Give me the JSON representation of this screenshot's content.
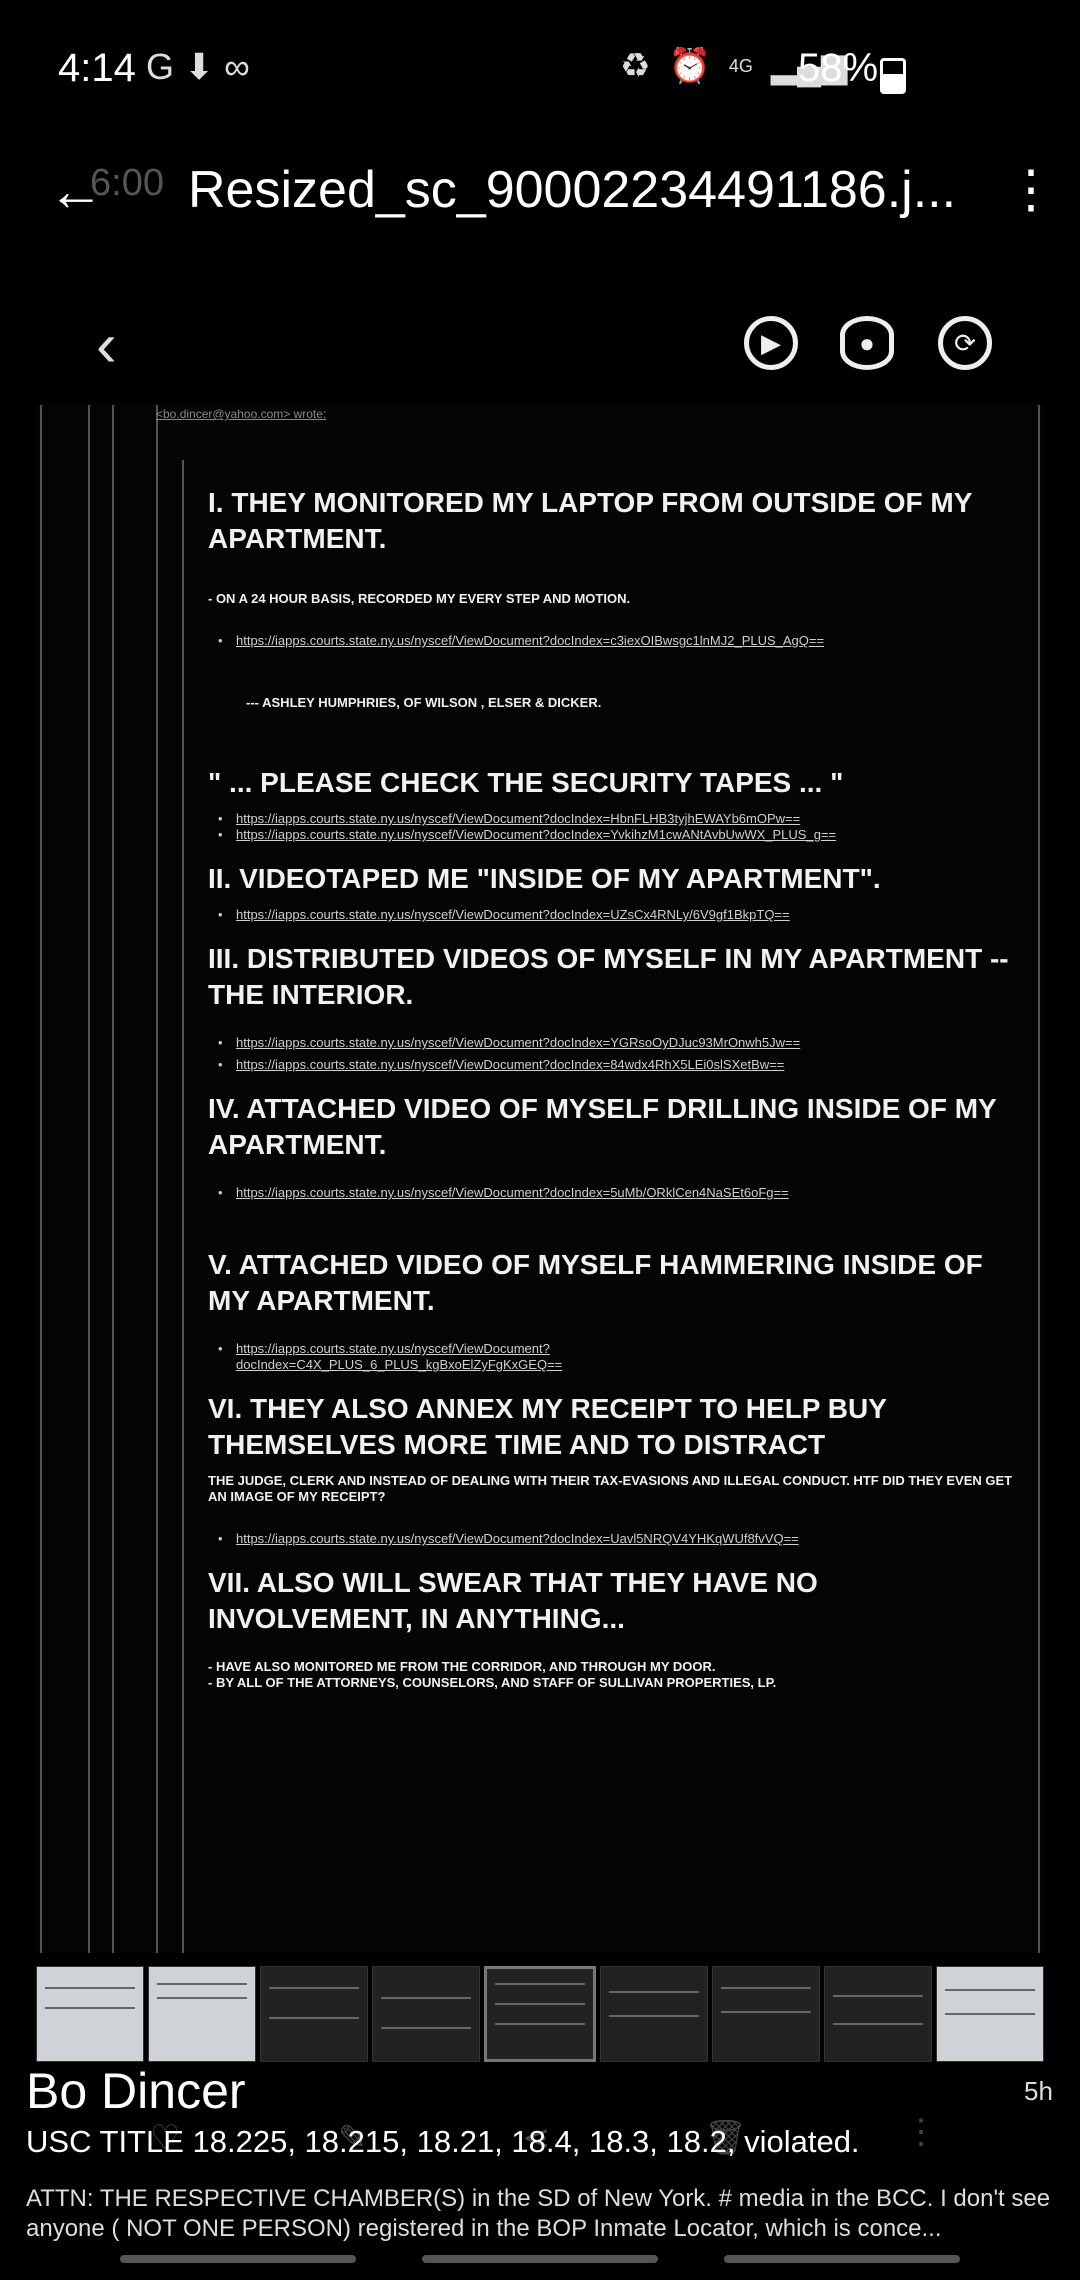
{
  "status_bar": {
    "time": "4:14",
    "left_icons": "G ⬇ ∞",
    "network": "4G",
    "battery_percent": "58%",
    "battery_level": 0.58
  },
  "app_bar": {
    "faded_background_text": "6:00",
    "title": "Resized_sc_90002234491186.j..."
  },
  "document": {
    "header_partial": "<bo.dincer@yahoo.com> wrote:",
    "section1_title": "I.    THEY MONITORED MY LAPTOP FROM OUTSIDE OF MY APARTMENT.",
    "section1_note": "- ON A 24 HOUR BASIS, RECORDED MY EVERY STEP AND MOTION.",
    "section1_link": "https://iapps.courts.state.ny.us/nyscef/ViewDocument?docIndex=c3iexOIBwsgc1lnMJ2_PLUS_AgQ==",
    "quote_author": "--- ASHLEY HUMPHRIES, OF WILSON , ELSER & DICKER.",
    "quote": "\" ... PLEASE CHECK THE SECURITY TAPES ... \"",
    "quote_link1": "https://iapps.courts.state.ny.us/nyscef/ViewDocument?docIndex=HbnFLHB3tyjhEWAYb6mOPw==",
    "quote_link2": "https://iapps.courts.state.ny.us/nyscef/ViewDocument?docIndex=YvkihzM1cwANtAvbUwWX_PLUS_g==",
    "section2_title": "II.    VIDEOTAPED ME \"INSIDE OF MY APARTMENT\".",
    "section2_link": "https://iapps.courts.state.ny.us/nyscef/ViewDocument?docIndex=UZsCx4RNLy/6V9gf1BkpTQ==",
    "section3_title": "III.    DISTRIBUTED VIDEOS OF MYSELF IN MY APARTMENT -- THE INTERIOR.",
    "section3_link1": "https://iapps.courts.state.ny.us/nyscef/ViewDocument?docIndex=YGRsoOyDJuc93MrOnwh5Jw==",
    "section3_link2": "https://iapps.courts.state.ny.us/nyscef/ViewDocument?docIndex=84wdx4RhX5LEi0slSXetBw==",
    "section4_title": "IV.    ATTACHED VIDEO OF MYSELF DRILLING INSIDE OF MY APARTMENT.",
    "section4_link": "https://iapps.courts.state.ny.us/nyscef/ViewDocument?docIndex=5uMb/ORklCen4NaSEt6oFg==",
    "section5_title": "V.    ATTACHED VIDEO OF MYSELF HAMMERING INSIDE OF MY APARTMENT.",
    "section5_link": "https://iapps.courts.state.ny.us/nyscef/ViewDocument?docIndex=C4X_PLUS_6_PLUS_kgBxoElZyFgKxGEQ==",
    "section6_title": "VI.    THEY ALSO ANNEX MY RECEIPT TO HELP BUY THEMSELVES MORE TIME AND TO DISTRACT",
    "section6_note": "THE JUDGE, CLERK AND INSTEAD OF DEALING WITH THEIR TAX-EVASIONS AND ILLEGAL CONDUCT. HTF DID THEY EVEN GET AN IMAGE OF MY RECEIPT?",
    "section6_link": "https://iapps.courts.state.ny.us/nyscef/ViewDocument?docIndex=Uavl5NRQV4YHKqWUf8fvVQ==",
    "section7_title": "VII.    ALSO WILL SWEAR THAT THEY HAVE NO INVOLVEMENT, IN ANYTHING...",
    "section7_note1": "- HAVE ALSO MONITORED ME FROM THE CORRIDOR, AND THROUGH MY DOOR.",
    "section7_note2": "- BY ALL OF THE ATTORNEYS, COUNSELORS, AND STAFF OF SULLIVAN PROPERTIES, LP."
  },
  "caption": {
    "author": "Bo Dincer",
    "age": "5h",
    "line1": "USC TITLE 18.225, 18.215, 18.21, 18.4, 18.3, 18.2, violated.",
    "line2": "ATTN: THE RESPECTIVE CHAMBER(S) in the SD of New York. # media in the BCC. I don't see anyone ( NOT ONE PERSON) registered in the BOP Inmate Locator, which is conce..."
  },
  "icons": {
    "back": "arrow-left-icon",
    "menu": "more-vert-icon",
    "prev": "chevron-left-icon",
    "motion": "motion-photo-icon",
    "view": "eye-icon",
    "rotate": "rotate-icon"
  }
}
